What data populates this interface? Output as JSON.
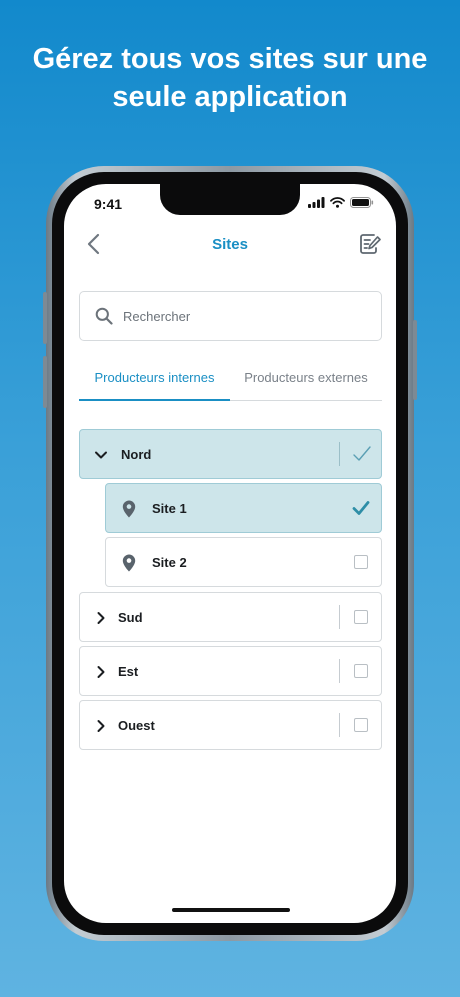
{
  "headline": {
    "line1": "Gérez tous vos sites sur une",
    "line2": "seule application"
  },
  "status_bar": {
    "time": "9:41"
  },
  "header": {
    "title": "Sites"
  },
  "search": {
    "placeholder": "Rechercher"
  },
  "tabs": [
    {
      "label": "Producteurs internes",
      "active": true
    },
    {
      "label": "Producteurs externes",
      "active": false
    }
  ],
  "regions": [
    {
      "label": "Nord",
      "expanded": true,
      "checked": true
    },
    {
      "label": "Sud",
      "expanded": false,
      "checked": false
    },
    {
      "label": "Est",
      "expanded": false,
      "checked": false
    },
    {
      "label": "Ouest",
      "expanded": false,
      "checked": false
    }
  ],
  "sites": [
    {
      "label": "Site 1",
      "checked": true
    },
    {
      "label": "Site 2",
      "checked": false
    }
  ],
  "colors": {
    "accent": "#1a8fc4",
    "selected_row": "#cde5ea",
    "check": "#2e8ea7"
  }
}
